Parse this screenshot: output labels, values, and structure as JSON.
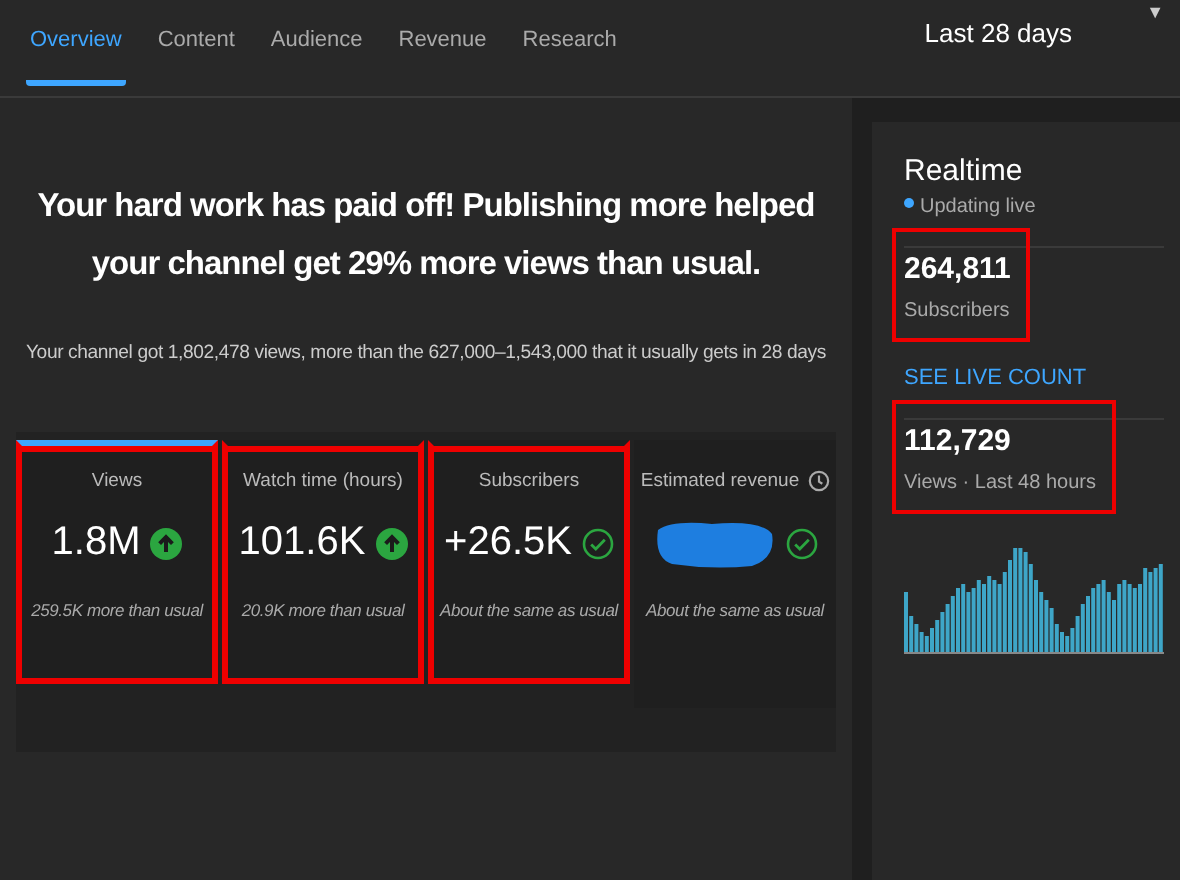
{
  "tabs": [
    {
      "label": "Overview",
      "selected": true
    },
    {
      "label": "Content",
      "selected": false
    },
    {
      "label": "Audience",
      "selected": false
    },
    {
      "label": "Revenue",
      "selected": false
    },
    {
      "label": "Research",
      "selected": false
    }
  ],
  "date_range": {
    "label": "Last 28 days",
    "menu_glyph": "▼"
  },
  "headline": "Your hard work has paid off! Publishing more helped your channel get 29% more views than usual.",
  "summary": "Your channel got 1,802,478 views, more than the 627,000–1,543,000 that it usually gets in 28 days",
  "metrics": [
    {
      "label": "Views",
      "value": "1.8M",
      "above_usual": true,
      "note": "259.5K more than usual",
      "selected": true,
      "highlighted": true,
      "redacted": false
    },
    {
      "label": "Watch time (hours)",
      "value": "101.6K",
      "above_usual": true,
      "note": "20.9K more than usual",
      "selected": false,
      "highlighted": true,
      "redacted": false
    },
    {
      "label": "Subscribers",
      "value": "+26.5K",
      "above_usual": false,
      "note": "About the same as usual",
      "selected": false,
      "highlighted": true,
      "redacted": false
    },
    {
      "label": "Estimated revenue",
      "above_usual": false,
      "note": "About the same as usual",
      "selected": false,
      "highlighted": false,
      "redacted": true,
      "info": true
    }
  ],
  "realtime": {
    "title": "Realtime",
    "status": "Updating live",
    "stats": [
      {
        "value": "264,811",
        "label": "Subscribers",
        "highlighted": true
      },
      {
        "value": "112,729",
        "label": "Views · Last 48 hours",
        "highlighted": true
      }
    ],
    "link": "SEE LIVE COUNT"
  }
}
